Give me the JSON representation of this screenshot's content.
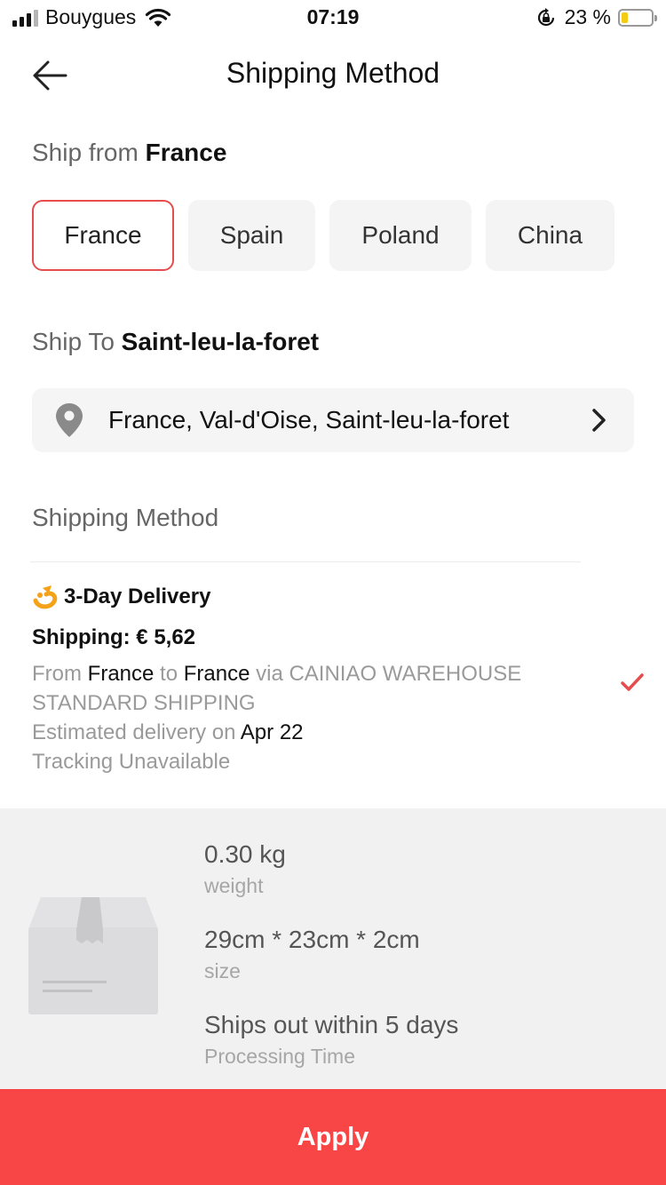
{
  "status_bar": {
    "carrier": "Bouygues",
    "time": "07:19",
    "battery_percent": "23 %",
    "battery_level": 0.23,
    "battery_color": "#f2cc12"
  },
  "header": {
    "title": "Shipping Method",
    "back_icon": "arrow-left-icon"
  },
  "ship_from": {
    "label": "Ship from",
    "value": "France",
    "options": [
      {
        "label": "France",
        "selected": true
      },
      {
        "label": "Spain",
        "selected": false
      },
      {
        "label": "Poland",
        "selected": false
      },
      {
        "label": "China",
        "selected": false
      }
    ]
  },
  "ship_to": {
    "label": "Ship To",
    "value": "Saint-leu-la-foret",
    "address": "France, Val-d'Oise, Saint-leu-la-foret",
    "pin_icon": "location-pin-icon"
  },
  "shipping_method": {
    "section_label": "Shipping Method",
    "options": [
      {
        "title": "3-Day Delivery",
        "price": "Shipping: € 5,62",
        "from_word": "From",
        "from": "France",
        "to_word": "to",
        "to": "France",
        "via_text": "via CAINIAO WAREHOUSE STANDARD SHIPPING",
        "estimate_text": "Estimated delivery on",
        "estimate_date": "Apr 22",
        "tracking": "Tracking Unavailable",
        "selected": true
      }
    ]
  },
  "package": {
    "weight_value": "0.30 kg",
    "weight_label": "weight",
    "size_value": "29cm * 23cm * 2cm",
    "size_label": "size",
    "processing_value": "Ships out within 5 days",
    "processing_label": "Processing Time"
  },
  "actions": {
    "apply_label": "Apply"
  },
  "colors": {
    "accent": "#f84646",
    "selected_border": "#e74c4c",
    "check": "#e74c4c"
  }
}
